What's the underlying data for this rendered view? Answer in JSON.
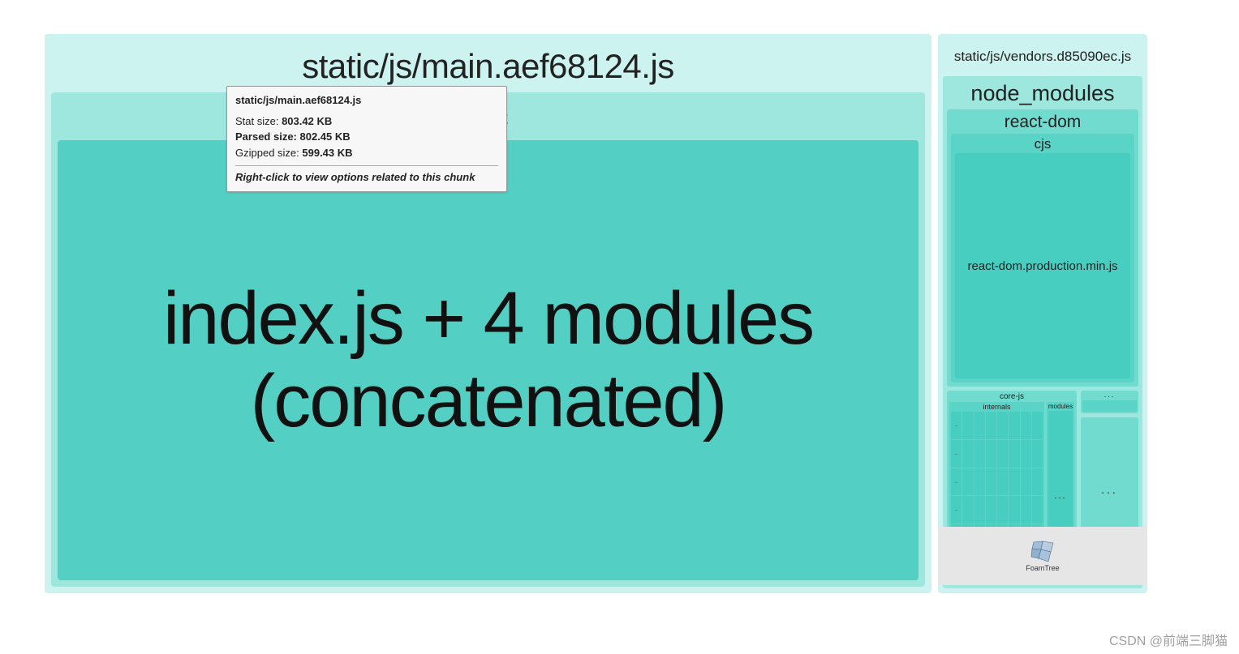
{
  "main": {
    "title": "static/js/main.aef68124.js",
    "src_label": "src",
    "concat_label": "index.js + 4 modules (concatenated)"
  },
  "vendors": {
    "title": "static/js/vendors.d85090ec.js",
    "node_modules_label": "node_modules",
    "react_dom_label": "react-dom",
    "cjs_label": "cjs",
    "prod_min_label": "react-dom.production.min.js",
    "corejs_label": "core-js",
    "internals_label": "internals",
    "modules_label": "modules",
    "ellipsis": "..."
  },
  "tooltip": {
    "title": "static/js/main.aef68124.js",
    "stat_label": "Stat size: ",
    "stat_value": "803.42 KB",
    "parsed_label": "Parsed size: ",
    "parsed_value": "802.45 KB",
    "gzip_label": "Gzipped size: ",
    "gzip_value": "599.43 KB",
    "hint": "Right-click to view options related to this chunk"
  },
  "foamtree_label": "FoamTree",
  "watermark": "CSDN @前端三脚猫"
}
